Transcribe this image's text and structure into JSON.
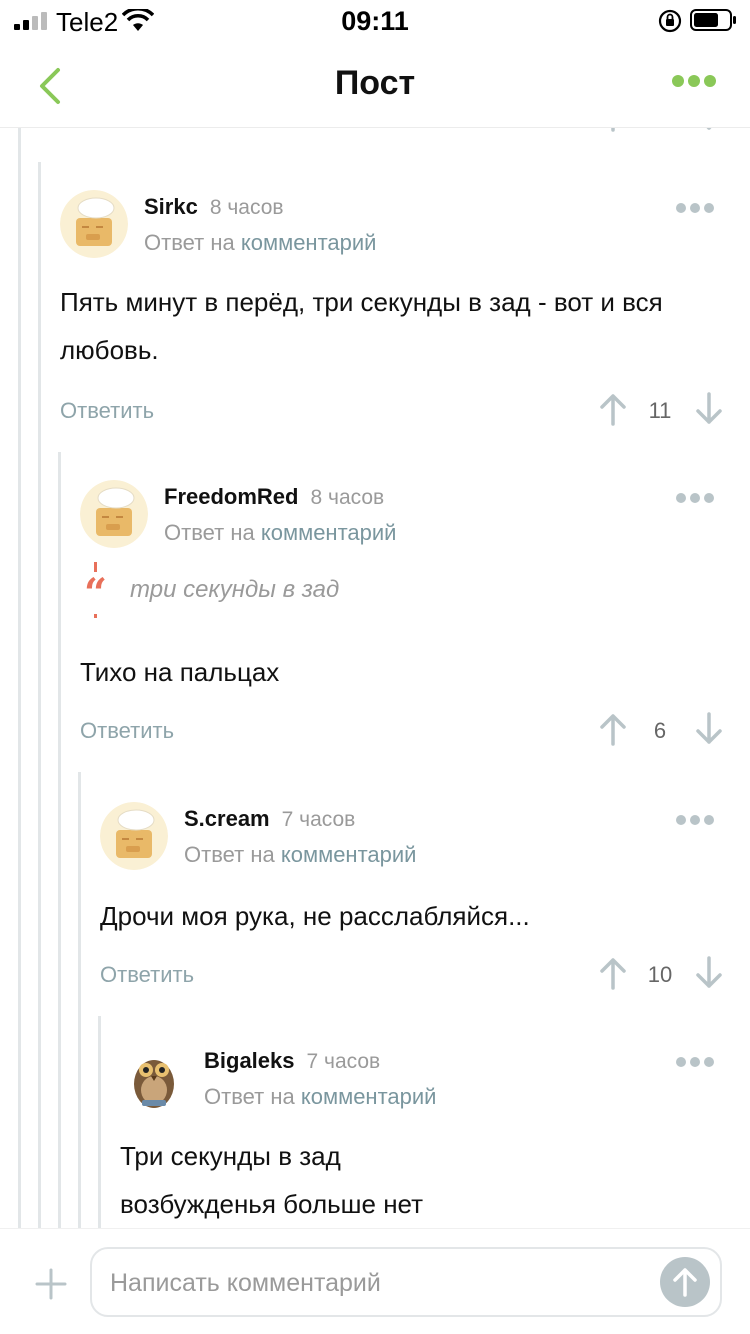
{
  "status_bar": {
    "carrier": "Tele2",
    "time": "09:11"
  },
  "nav": {
    "title": "Пост"
  },
  "composer": {
    "placeholder": "Написать комментарий"
  },
  "comments": [
    {
      "author": "Sirkc",
      "time": "8 часов",
      "reply_prefix": "Ответ на",
      "reply_link": "комментарий",
      "text": "Пять минут в перёд, три секунды в зад - вот и вся любовь.",
      "reply_label": "Ответить",
      "votes": "11"
    },
    {
      "author": "FreedomRed",
      "time": "8 часов",
      "reply_prefix": "Ответ на",
      "reply_link": "комментарий",
      "quote": "три секунды в зад",
      "text": "Тихо на пальцах",
      "reply_label": "Ответить",
      "votes": "6"
    },
    {
      "author": "S.cream",
      "time": "7 часов",
      "reply_prefix": "Ответ на",
      "reply_link": "комментарий",
      "text": "Дрочи моя рука, не расслабляйся...",
      "reply_label": "Ответить",
      "votes": "10"
    },
    {
      "author": "Bigaleks",
      "time": "7 часов",
      "reply_prefix": "Ответ на",
      "reply_link": "комментарий",
      "text_lines": [
        "Три секунды в зад",
        "возбужденья больше нет"
      ]
    }
  ],
  "colors": {
    "accent": "#8ac858",
    "muted_link": "#7a969e",
    "quote": "#e8705a"
  },
  "icons": [
    "back-chevron-icon",
    "more-dots-icon",
    "arrow-up-icon",
    "arrow-down-icon",
    "plus-icon",
    "send-arrow-icon"
  ]
}
